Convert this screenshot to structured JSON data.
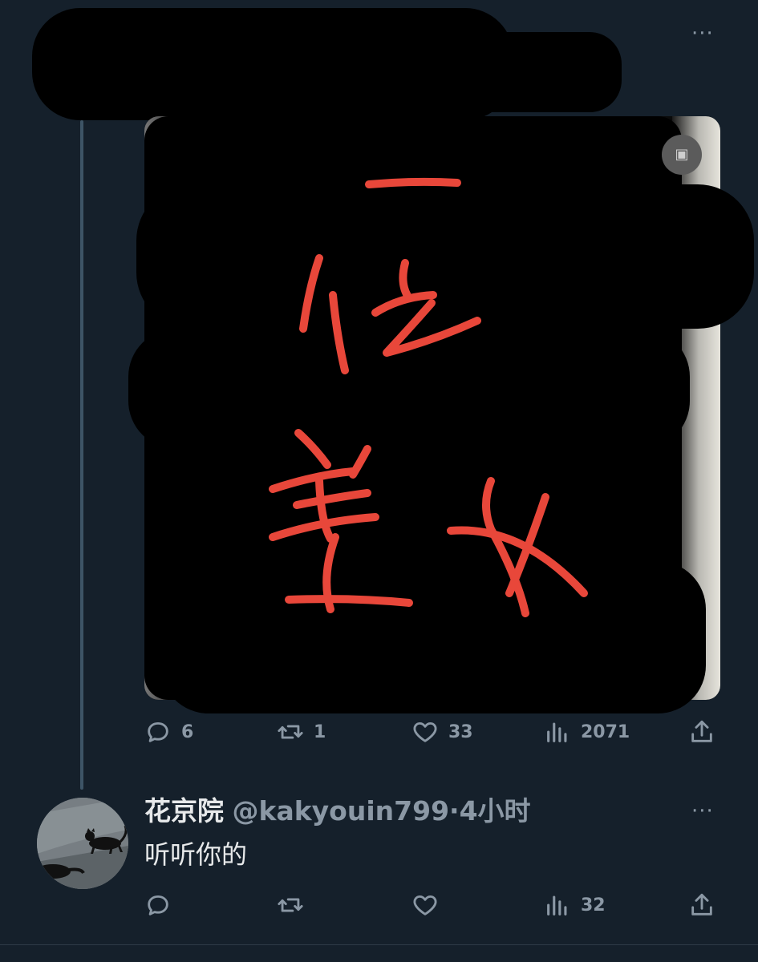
{
  "tweet": {
    "stats": {
      "replies": "6",
      "retweets": "1",
      "likes": "33",
      "views": "2071"
    },
    "media": {
      "scribble_text": "一位美女",
      "badge_icon": "camera-icon"
    }
  },
  "reply": {
    "display_name": "花京院",
    "handle": "@kakyouin799",
    "separator": "·",
    "time": "4小时",
    "text": "听听你的",
    "stats": {
      "views": "32"
    }
  },
  "colors": {
    "background": "#15202b",
    "secondary_text": "#8b98a5",
    "scribble_red": "#e8473a"
  }
}
